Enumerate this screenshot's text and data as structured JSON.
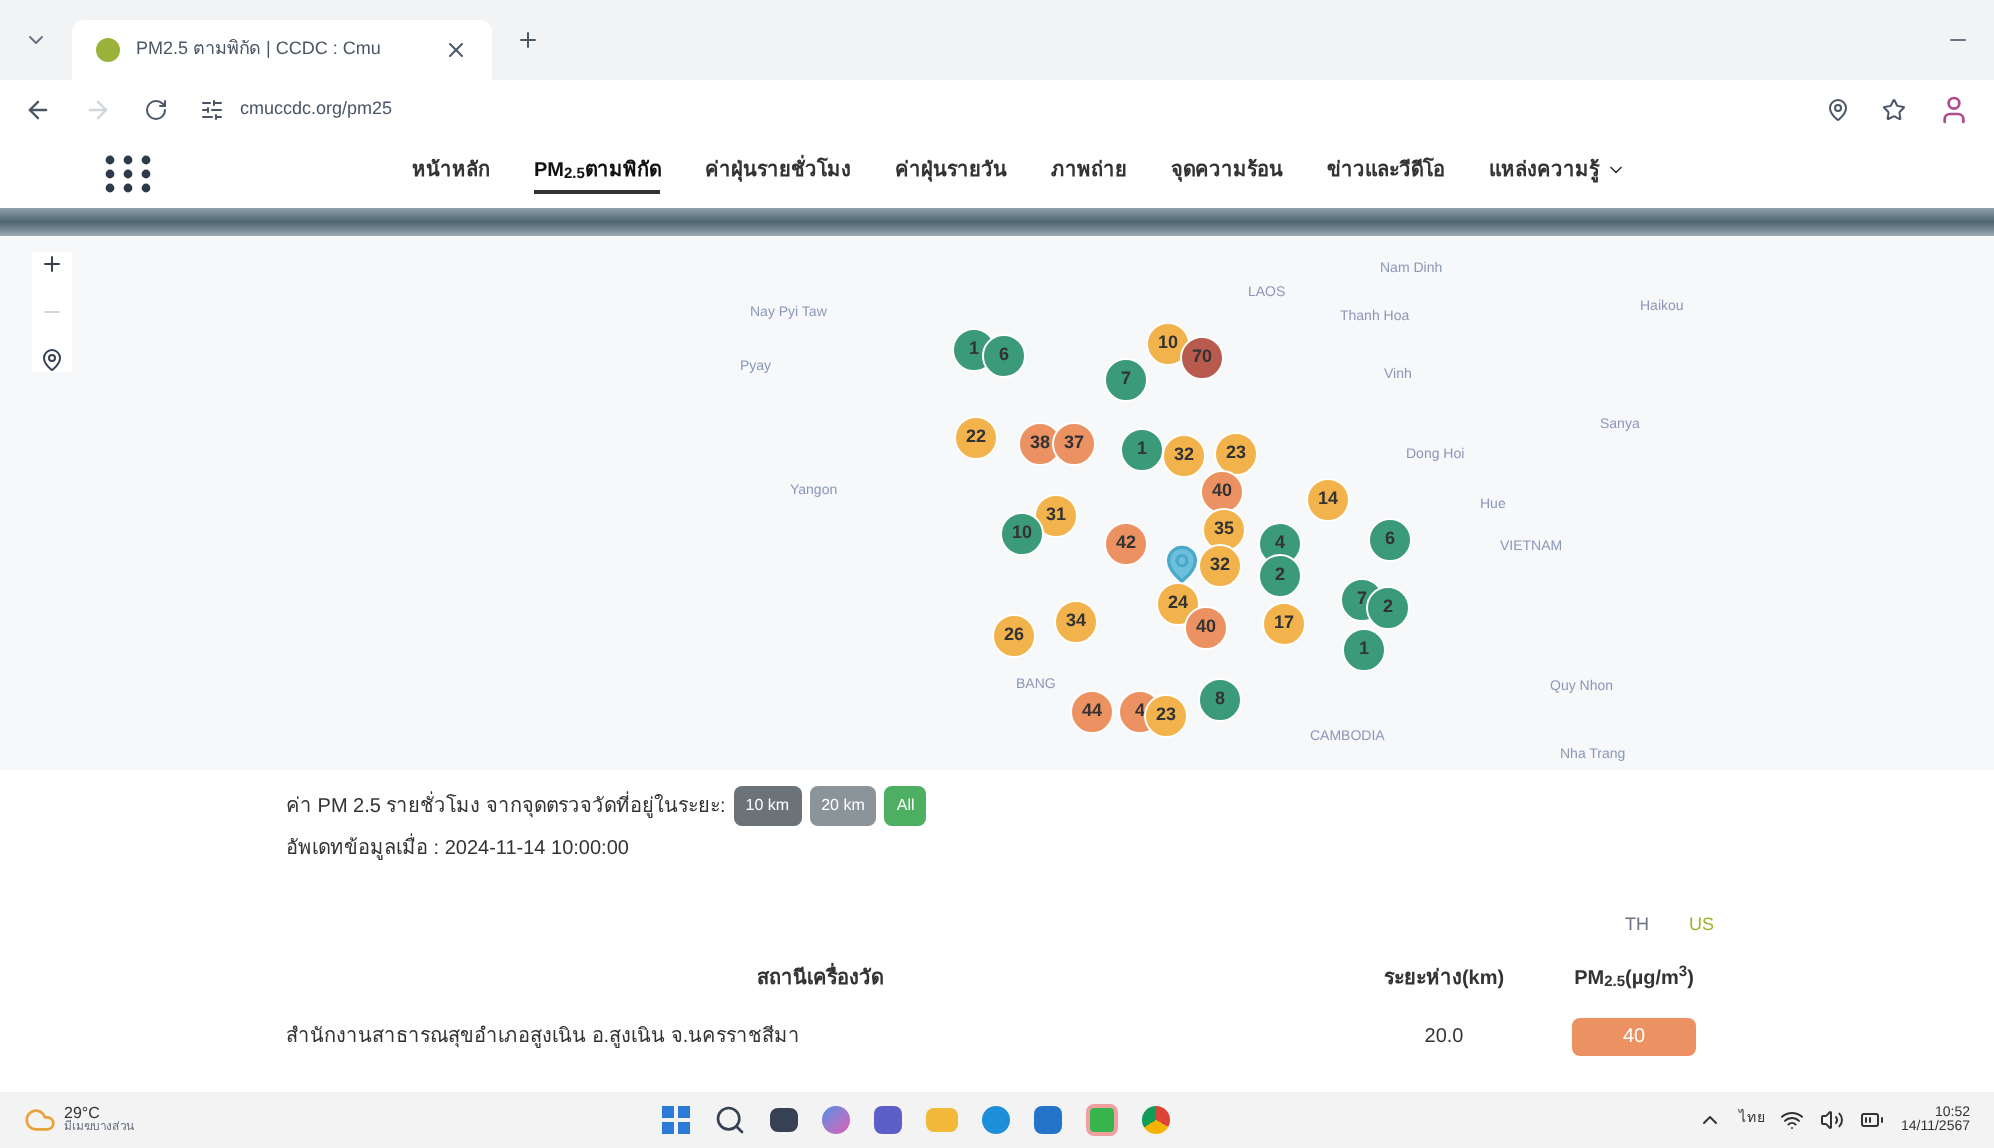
{
  "browser": {
    "tab_title": "PM2.5 ตามพิกัด | CCDC : Cmu",
    "url": "cmuccdc.org/pm25"
  },
  "nav": {
    "items": [
      {
        "label": "หน้าหลัก",
        "selected": false
      },
      {
        "label": "PM$_{2.5}$ตามพิกัด",
        "selected": true
      },
      {
        "label": "ค่าฝุ่นรายชั่วโมง",
        "selected": false
      },
      {
        "label": "ค่าฝุ่นรายวัน",
        "selected": false
      },
      {
        "label": "ภาพถ่าย",
        "selected": false
      },
      {
        "label": "จุดความร้อน",
        "selected": false
      },
      {
        "label": "ข่าวและวีดีโอ",
        "selected": false
      },
      {
        "label": "แหล่งความรู้",
        "selected": false,
        "kind": "dropdown"
      }
    ]
  },
  "map": {
    "labels": [
      "Nam Dinh",
      "LAOS",
      "Haikou",
      "Nay Pyi Taw",
      "Thanh Hoa",
      "Pyay",
      "Vinh",
      "Sanya",
      "Dong Hoi",
      "Yangon",
      "Hue",
      "VIETNAM",
      "BANG",
      "Quy Nhon",
      "CAMBODIA",
      "Nha Trang"
    ],
    "markers": [
      {
        "value": "1",
        "color": "#3a9a7a"
      },
      {
        "value": "6",
        "color": "#3a9a7a"
      },
      {
        "value": "10",
        "color": "#f3b34c"
      },
      {
        "value": "70",
        "color": "#b85a4e"
      },
      {
        "value": "7",
        "color": "#3a9a7a"
      },
      {
        "value": "22",
        "color": "#f3b34c"
      },
      {
        "value": "38",
        "color": "#ec9161"
      },
      {
        "value": "37",
        "color": "#ec9161"
      },
      {
        "value": "1",
        "color": "#3a9a7a"
      },
      {
        "value": "32",
        "color": "#f3b34c"
      },
      {
        "value": "23",
        "color": "#f3b34c"
      },
      {
        "value": "40",
        "color": "#ec9161"
      },
      {
        "value": "31",
        "color": "#f3b34c"
      },
      {
        "value": "10",
        "color": "#3a9a7a"
      },
      {
        "value": "42",
        "color": "#ec9161"
      },
      {
        "value": "35",
        "color": "#f3b34c"
      },
      {
        "value": "32",
        "color": "#f3b34c"
      },
      {
        "value": "4",
        "color": "#3a9a7a"
      },
      {
        "value": "2",
        "color": "#3a9a7a"
      },
      {
        "value": "14",
        "color": "#f3b34c"
      },
      {
        "value": "6",
        "color": "#3a9a7a"
      },
      {
        "value": "7",
        "color": "#3a9a7a"
      },
      {
        "value": "2",
        "color": "#3a9a7a"
      },
      {
        "value": "1",
        "color": "#3a9a7a"
      },
      {
        "value": "24",
        "color": "#f3b34c"
      },
      {
        "value": "40",
        "color": "#ec9161"
      },
      {
        "value": "17",
        "color": "#f3b34c"
      },
      {
        "value": "26",
        "color": "#f3b34c"
      },
      {
        "value": "34",
        "color": "#f3b34c"
      },
      {
        "value": "44",
        "color": "#ec9161"
      },
      {
        "value": "4",
        "color": "#ec9161"
      },
      {
        "value": "23",
        "color": "#f3b34c"
      },
      {
        "value": "8",
        "color": "#3a9a7a"
      }
    ]
  },
  "info": {
    "caption": "ค่า PM 2.5 รายชั่วโมง จากจุดตรวจวัดที่อยู่ในระยะ:",
    "ranges": [
      {
        "label": "10 km",
        "selected": false
      },
      {
        "label": "20 km",
        "selected": false
      },
      {
        "label": "All",
        "selected": true
      }
    ],
    "updated": "อัพเดทข้อมูลเมื่อ : 2024-11-14 10:00:00"
  },
  "standards": [
    {
      "label": "TH",
      "selected": false
    },
    {
      "label": "US",
      "selected": true
    }
  ],
  "table": {
    "columns": [
      "สถานีเครื่องวัด",
      "ระยะห่าง(km)",
      "PM$_{2.5}$(µg/m$^{3}$)"
    ],
    "rows": [
      {
        "station": "สำนักงานสาธารณสุขอำเภอสูงเนิน อ.สูงเนิน จ.นครราชสีมา",
        "distance": "20.0",
        "pm25": "40",
        "color": "#ec9161"
      }
    ]
  },
  "taskbar": {
    "temperature": "29°C",
    "weather": "มีเมฆบางส่วน",
    "language": "ไทย",
    "time": "10:52",
    "date": "14/11/2567"
  }
}
